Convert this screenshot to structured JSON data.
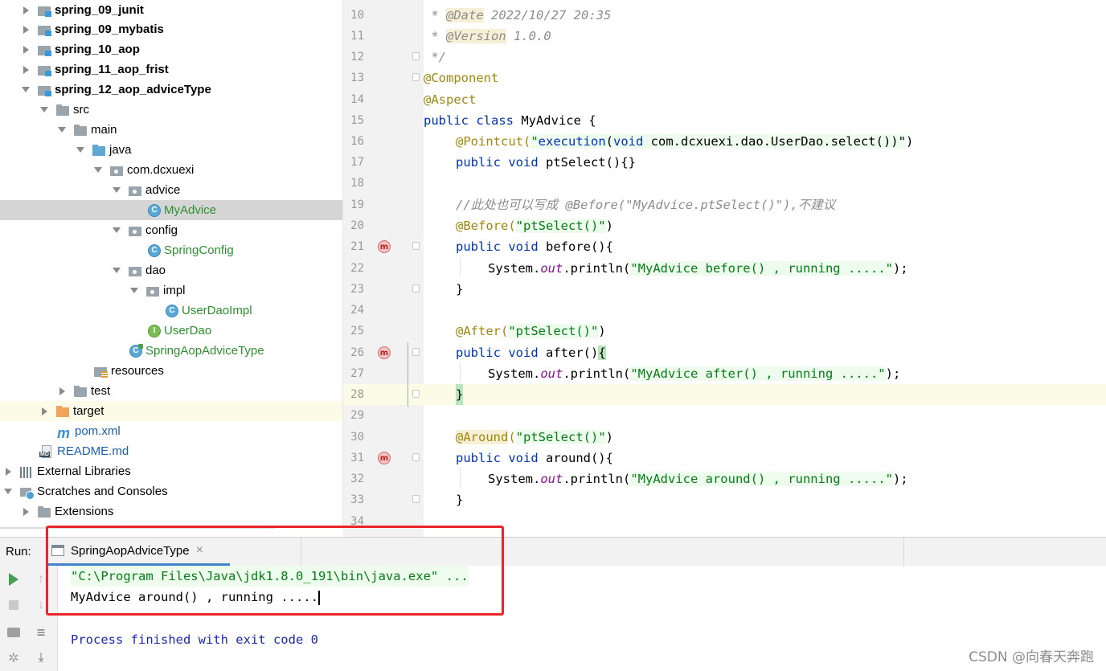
{
  "project_tree": {
    "items": [
      {
        "label": "spring_09_junit",
        "icon": "module-folder-icon",
        "bold": true
      },
      {
        "label": "spring_09_mybatis",
        "icon": "module-folder-icon",
        "bold": true
      },
      {
        "label": "spring_10_aop",
        "icon": "module-folder-icon",
        "bold": true
      },
      {
        "label": "spring_11_aop_frist",
        "icon": "module-folder-icon",
        "bold": true
      },
      {
        "label": "spring_12_aop_adviceType",
        "icon": "module-folder-icon",
        "bold": true
      },
      {
        "label": "src",
        "icon": "folder-icon"
      },
      {
        "label": "main",
        "icon": "folder-icon"
      },
      {
        "label": "java",
        "icon": "source-folder-icon"
      },
      {
        "label": "com.dcxuexi",
        "icon": "package-icon"
      },
      {
        "label": "advice",
        "icon": "package-icon"
      },
      {
        "label": "MyAdvice",
        "icon": "class-icon"
      },
      {
        "label": "config",
        "icon": "package-icon"
      },
      {
        "label": "SpringConfig",
        "icon": "class-icon"
      },
      {
        "label": "dao",
        "icon": "package-icon"
      },
      {
        "label": "impl",
        "icon": "package-icon"
      },
      {
        "label": "UserDaoImpl",
        "icon": "class-icon"
      },
      {
        "label": "UserDao",
        "icon": "interface-icon"
      },
      {
        "label": "SpringAopAdviceType",
        "icon": "main-class-icon"
      },
      {
        "label": "resources",
        "icon": "resources-folder-icon"
      },
      {
        "label": "test",
        "icon": "folder-icon"
      },
      {
        "label": "target",
        "icon": "excluded-folder-icon"
      },
      {
        "label": "pom.xml",
        "icon": "maven-icon"
      },
      {
        "label": "README.md",
        "icon": "markdown-icon"
      },
      {
        "label": "External Libraries",
        "icon": "libraries-icon"
      },
      {
        "label": "Scratches and Consoles",
        "icon": "scratches-icon"
      },
      {
        "label": "Extensions",
        "icon": "folder-icon"
      }
    ]
  },
  "editor": {
    "line_numbers": [
      "10",
      "11",
      "12",
      "13",
      "14",
      "15",
      "16",
      "17",
      "18",
      "19",
      "20",
      "21",
      "22",
      "23",
      "24",
      "25",
      "26",
      "27",
      "28",
      "29",
      "30",
      "31",
      "32",
      "33",
      "34"
    ],
    "lines": {
      "l10_pre": " * ",
      "l10_tag": "@Date",
      "l10_rest": " 2022/10/27 20:35",
      "l11_pre": " * ",
      "l11_tag": "@Version",
      "l11_rest": " 1.0.0",
      "l12": " */",
      "l13": "@Component",
      "l14": "@Aspect",
      "l15_kw": "public class",
      "l15_rest": " MyAdvice {",
      "l16_ann": "@Pointcut(",
      "l16_s1": "\"",
      "l16_kw1": "execution",
      "l16_s2": "(",
      "l16_kw2": "void",
      "l16_s3": " com.dcxuexi.dao.UserDao.select())\"",
      "l16_end": ")",
      "l17_kw": "public void",
      "l17_rest": " ptSelect(){}",
      "l19": "//此处也可以写成 @Before(\"MyAdvice.ptSelect()\"),不建议",
      "l20_ann": "@Before(",
      "l20_s": "\"ptSelect()\"",
      "l20_end": ")",
      "l21_kw": "public void",
      "l21_rest": " before(){",
      "l22_a": "System.",
      "l22_f": "out",
      "l22_b": ".println(",
      "l22_s": "\"MyAdvice before() , running .....\"",
      "l22_end": ");",
      "l23": "}",
      "l25_ann": "@After(",
      "l25_s": "\"ptSelect()\"",
      "l25_end": ")",
      "l26_kw": "public void",
      "l26_rest": " after()",
      "l26_brace": "{",
      "l27_a": "System.",
      "l27_f": "out",
      "l27_b": ".println(",
      "l27_s": "\"MyAdvice after() , running .....\"",
      "l27_end": ");",
      "l28": "}",
      "l30_ann1": "@",
      "l30_ann2": "Around",
      "l30_ann3": "(",
      "l30_s": "\"ptSelect()\"",
      "l30_end": ")",
      "l31_kw": "public void",
      "l31_rest": " around(){",
      "l32_a": "System.",
      "l32_f": "out",
      "l32_b": ".println(",
      "l32_s": "\"MyAdvice around() , running .....\"",
      "l32_end": ");",
      "l33": "}"
    },
    "gutter_marker": "m"
  },
  "run_panel": {
    "label": "Run:",
    "tab_label": "SpringAopAdviceType",
    "tab_close": "×",
    "console": {
      "command": "\"C:\\Program Files\\Java\\jdk1.8.0_191\\bin\\java.exe\" ...",
      "output": "MyAdvice around() , running .....",
      "exit": "Process finished with exit code 0"
    }
  },
  "watermark": "CSDN @向春天奔跑",
  "colors": {
    "highlight_box": "#e8272c",
    "tab_underline": "#4083c9",
    "run_green": "#499c54"
  }
}
